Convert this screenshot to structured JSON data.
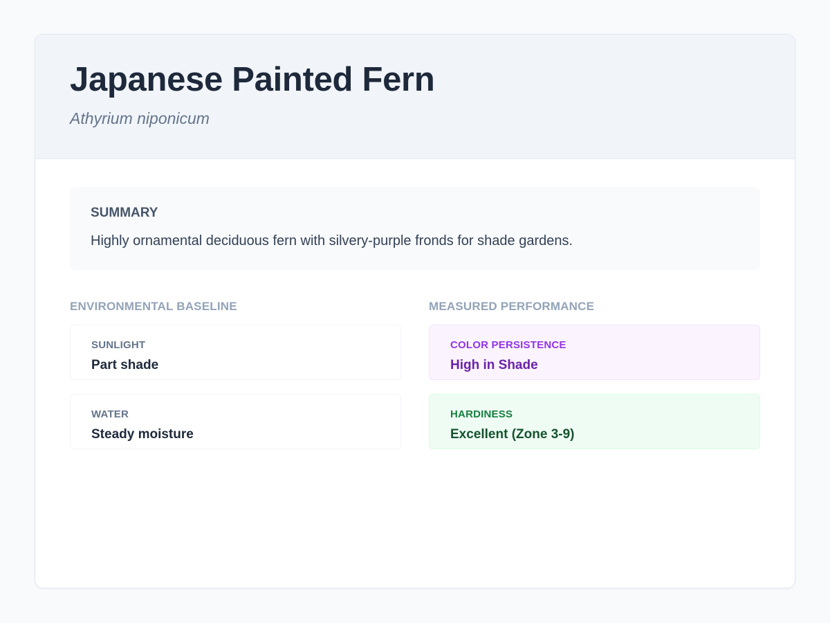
{
  "header": {
    "title": "Japanese Painted Fern",
    "scientific_name": "Athyrium niponicum"
  },
  "summary": {
    "heading": "SUMMARY",
    "text": "Highly ornamental deciduous fern with silvery-purple fronds for shade gardens."
  },
  "environmental_baseline": {
    "heading": "ENVIRONMENTAL BASELINE",
    "items": [
      {
        "label": "SUNLIGHT",
        "value": "Part shade"
      },
      {
        "label": "WATER",
        "value": "Steady moisture"
      }
    ]
  },
  "measured_performance": {
    "heading": "MEASURED PERFORMANCE",
    "items": [
      {
        "label": "COLOR PERSISTENCE",
        "value": "High in Shade",
        "colors": {
          "background": "#fbf4fe",
          "border": "#f3e4fb",
          "label": "#9333ea",
          "value": "#6b21a8"
        }
      },
      {
        "label": "HARDINESS",
        "value": "Excellent (Zone 3-9)",
        "colors": {
          "background": "#effcf4",
          "border": "#dcfce7",
          "label": "#15803d",
          "value": "#14532d"
        }
      }
    ]
  },
  "colors": {
    "page_background": "#f8fafc",
    "header_background": "#f1f5f9",
    "title": "#1e293b",
    "subtitle": "#64748b",
    "section_heading": "#94a3b8",
    "baseline_label": "#64748b",
    "baseline_value": "#1e293b"
  }
}
